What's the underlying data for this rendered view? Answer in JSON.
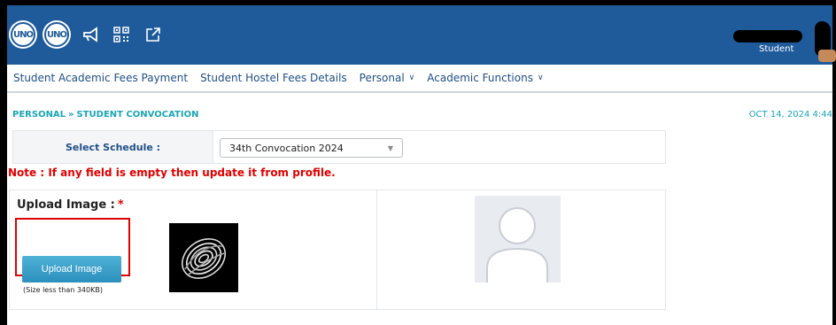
{
  "header": {
    "logo_text_1": "UNO",
    "logo_text_2": "UNO",
    "icons": [
      "megaphone-icon",
      "qr-code-icon",
      "external-link-icon"
    ],
    "user_role": "Student",
    "bar_color": "#1f5b9b"
  },
  "menu": {
    "items": [
      {
        "label": "Student Academic Fees Payment",
        "has_dropdown": false
      },
      {
        "label": "Student Hostel Fees Details",
        "has_dropdown": false
      },
      {
        "label": "Personal",
        "has_dropdown": true
      },
      {
        "label": "Academic Functions",
        "has_dropdown": true
      }
    ]
  },
  "breadcrumb": {
    "parent": "PERSONAL",
    "separator": "»",
    "current": "STUDENT CONVOCATION",
    "date": "OCT 14, 2024 4:44"
  },
  "schedule": {
    "label": "Select Schedule :",
    "selected": "34th Convocation 2024"
  },
  "note": "Note : If any field is empty then update it from profile.",
  "upload": {
    "title": "Upload Image :",
    "required_mark": "*",
    "button_label": "Upload Image",
    "size_hint": "(Size less than 340KB)"
  }
}
